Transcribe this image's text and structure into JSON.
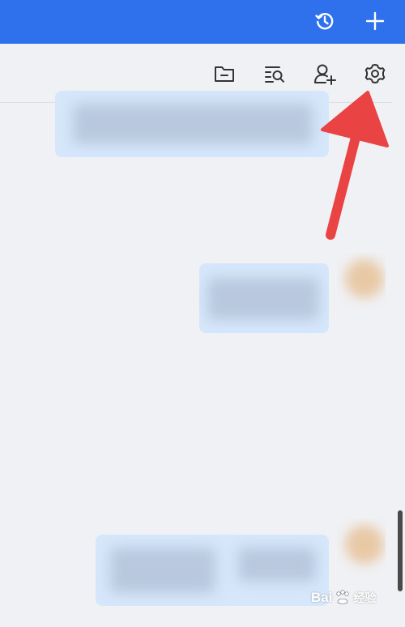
{
  "topbar": {
    "background": "#2f71ed",
    "history_icon": "history-clock-icon",
    "add_icon": "plus-icon"
  },
  "toolbar": {
    "icons": [
      "folder-icon",
      "search-list-icon",
      "add-contact-icon",
      "gear-icon"
    ]
  },
  "annotation": {
    "arrow_color": "#e94343",
    "points_to": "gear-icon"
  },
  "watermark": {
    "brand": "Bai",
    "brand_suffix": "经验"
  }
}
